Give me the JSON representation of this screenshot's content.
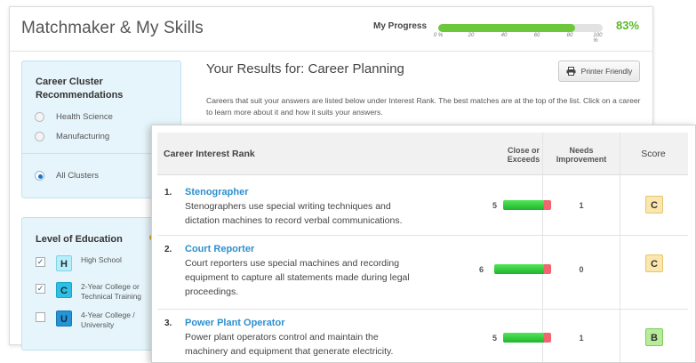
{
  "header": {
    "title": "Matchmaker & My Skills",
    "progress_label": "My Progress",
    "progress_value": 0.83,
    "progress_percent_text": "83%",
    "progress_ticks": [
      "0 %",
      "20",
      "40",
      "60",
      "80",
      "100 %"
    ],
    "progress_color": "#6cc83a"
  },
  "cluster_panel": {
    "title_line1": "Career Cluster",
    "title_line2": "Recommendations",
    "options": [
      {
        "label": "Health Science",
        "selected": false
      },
      {
        "label": "Manufacturing",
        "selected": false
      },
      {
        "label": "All Clusters",
        "selected": true
      }
    ]
  },
  "education_panel": {
    "title": "Level of Education",
    "items": [
      {
        "badge": "H",
        "label_line1": "High School",
        "label_line2": "",
        "checked": true
      },
      {
        "badge": "C",
        "label_line1": "2-Year College or",
        "label_line2": "Technical Training",
        "checked": true
      },
      {
        "badge": "U",
        "label_line1": "4-Year College /",
        "label_line2": "University",
        "checked": false
      }
    ]
  },
  "results": {
    "title": "Your Results for: Career Planning",
    "printer_button": "Printer Friendly",
    "intro": "Careers that suit your answers are listed below under Interest Rank. The best matches are at the top of the list. Click on a career to learn more about it and how it suits your answers."
  },
  "table": {
    "col_rank": "Career Interest Rank",
    "col_close_line1": "Close or",
    "col_close_line2": "Exceeds",
    "col_needs_line1": "Needs",
    "col_needs_line2": "Improvement",
    "col_score": "Score",
    "rows": [
      {
        "num": "1.",
        "name": "Stenographer",
        "desc_line1": "Stenographers use special writing techniques and",
        "desc_line2": "dictation machines to record verbal communications.",
        "desc_line3": "",
        "close": "5",
        "needs": "1",
        "score": "C"
      },
      {
        "num": "2.",
        "name": "Court Reporter",
        "desc_line1": "Court reporters use special machines and recording",
        "desc_line2": "equipment to capture all statements made during legal",
        "desc_line3": "proceedings.",
        "close": "6",
        "needs": "0",
        "score": "C"
      },
      {
        "num": "3.",
        "name": "Power Plant Operator",
        "desc_line1": "Power plant operators control and maintain the",
        "desc_line2": "machinery and equipment that generate electricity.",
        "desc_line3": "",
        "close": "5",
        "needs": "1",
        "score": "B"
      }
    ]
  }
}
